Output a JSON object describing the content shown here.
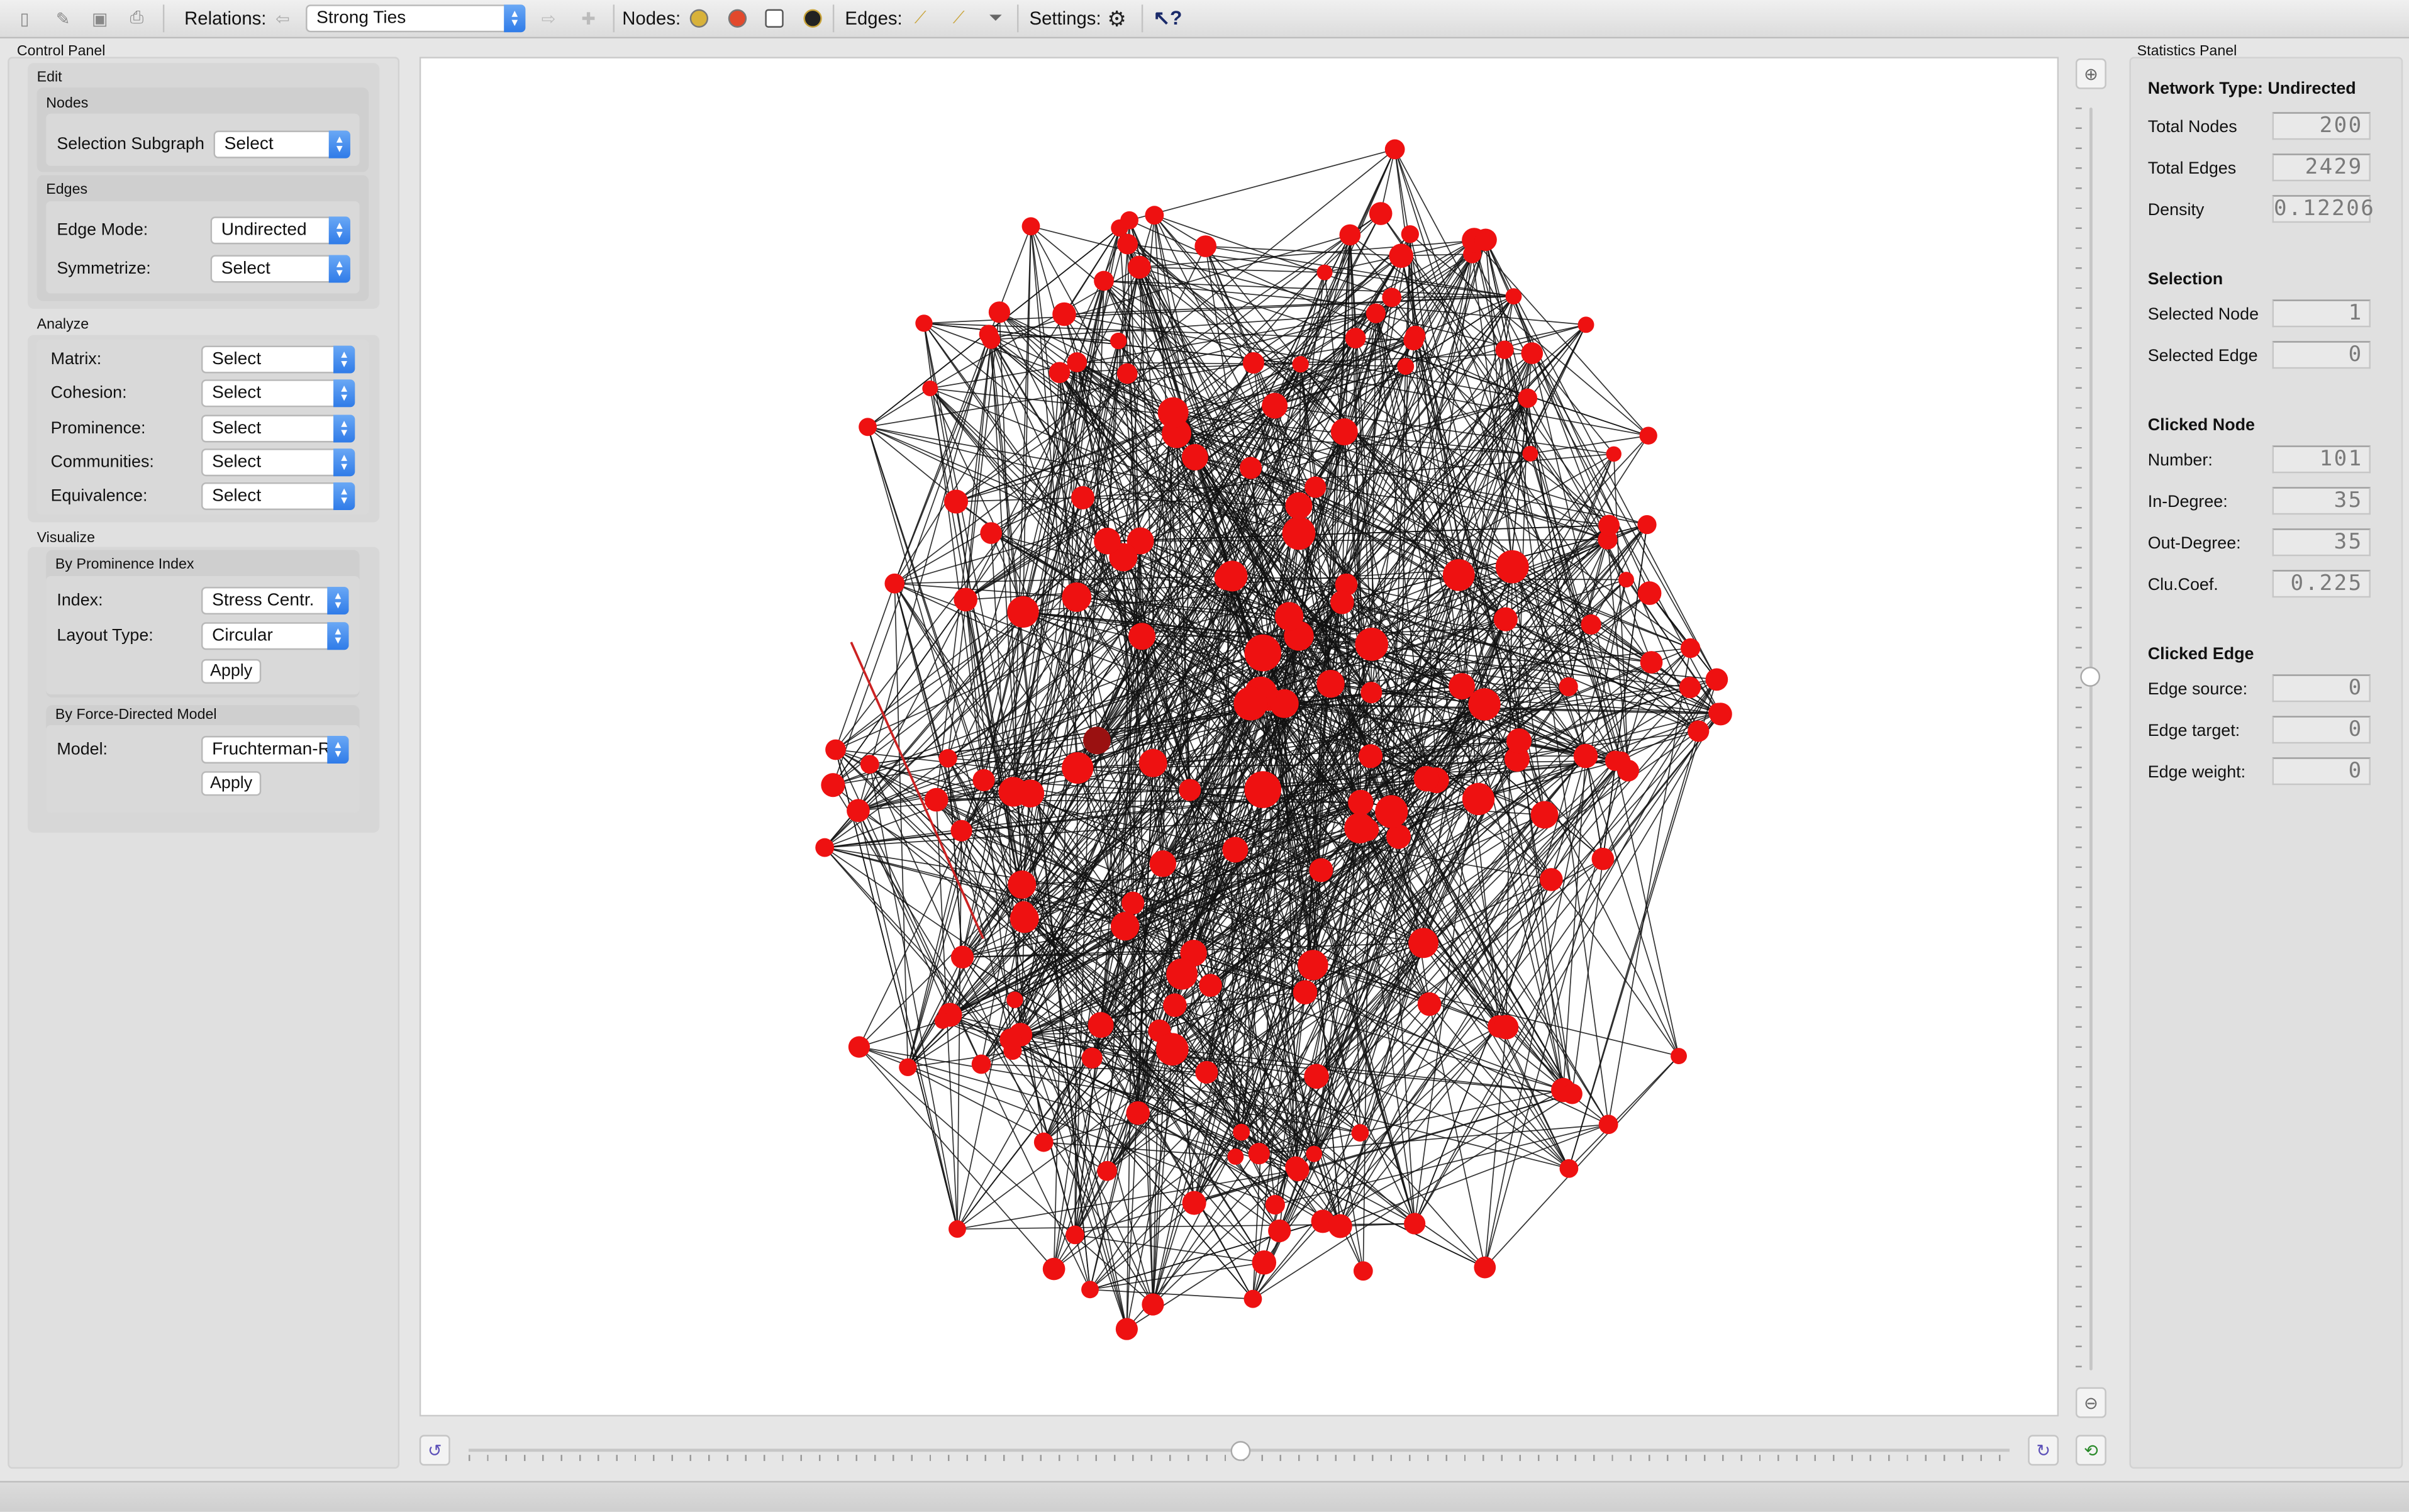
{
  "toolbar": {
    "relations_label": "Relations:",
    "relation_selected": "Strong Ties",
    "nodes_label": "Nodes:",
    "edges_label": "Edges:",
    "settings_label": "Settings:"
  },
  "control_panel": {
    "title": "Control Panel",
    "edit_title": "Edit",
    "nodes_title": "Nodes",
    "selection_subgraph_label": "Selection Subgraph",
    "selection_subgraph_value": "Select",
    "edges_title": "Edges",
    "edge_mode_label": "Edge Mode:",
    "edge_mode_value": "Undirected",
    "symmetrize_label": "Symmetrize:",
    "symmetrize_value": "Select",
    "analyze_title": "Analyze",
    "analyze_rows": [
      {
        "label": "Matrix:",
        "value": "Select"
      },
      {
        "label": "Cohesion:",
        "value": "Select"
      },
      {
        "label": "Prominence:",
        "value": "Select"
      },
      {
        "label": "Communities:",
        "value": "Select"
      },
      {
        "label": "Equivalence:",
        "value": "Select"
      }
    ],
    "visualize_title": "Visualize",
    "prominence_title": "By Prominence Index",
    "index_label": "Index:",
    "index_value": "Stress Centr.",
    "layout_label": "Layout Type:",
    "layout_value": "Circular",
    "apply_label": "Apply",
    "force_title": "By Force-Directed Model",
    "model_label": "Model:",
    "model_value": "Fruchterman-R",
    "apply2_label": "Apply"
  },
  "statistics_panel": {
    "title": "Statistics Panel",
    "network_type": "Network Type: Undirected",
    "total_nodes_label": "Total Nodes",
    "total_nodes": "200",
    "total_edges_label": "Total Edges",
    "total_edges": "2429",
    "density_label": "Density",
    "density": "0.12206",
    "selection_title": "Selection",
    "selected_node_label": "Selected Node",
    "selected_node": "1",
    "selected_edge_label": "Selected Edge",
    "selected_edge": "0",
    "clicked_node_title": "Clicked Node",
    "number_label": "Number:",
    "number": "101",
    "in_degree_label": "In-Degree:",
    "in_degree": "35",
    "out_degree_label": "Out-Degree:",
    "out_degree": "35",
    "clu_coef_label": "Clu.Coef.",
    "clu_coef": "0.225",
    "clicked_edge_title": "Clicked Edge",
    "edge_source_label": "Edge source:",
    "edge_source": "0",
    "edge_target_label": "Edge target:",
    "edge_target": "0",
    "edge_weight_label": "Edge weight:",
    "edge_weight": "0"
  },
  "graph": {
    "node_color": "#ee1111",
    "edge_color": "#111111",
    "highlight_edge_color": "#cc2222"
  },
  "sliders": {
    "zoom_level": 0.55,
    "rotation_level": 0.5
  }
}
